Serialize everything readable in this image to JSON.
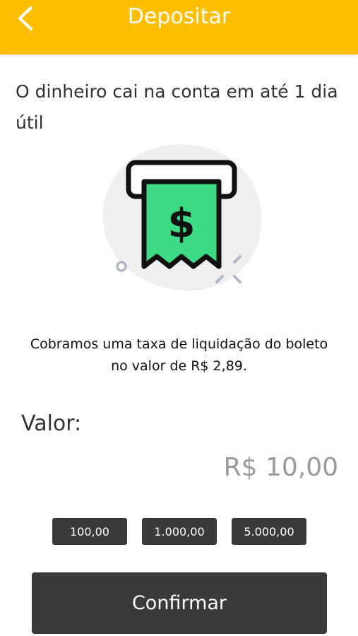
{
  "colors": {
    "header_bg": "#FFBE00",
    "button_bg": "#3a3a3c",
    "receipt_green": "#3ddc84",
    "amount_text": "#9a9a9a"
  },
  "header": {
    "title": "Depositar",
    "back_icon": "chevron-left-icon"
  },
  "main": {
    "headline": "O dinheiro cai na conta em até 1 dia útil",
    "illustration_icon": "boleto-receipt-icon",
    "fee_note": "Cobramos uma taxa de liquidação do boleto no valor de R$ 2,89.",
    "valor_label": "Valor:",
    "amount_value": "R$ 10,00",
    "quick_amounts": [
      "100,00",
      "1.000,00",
      "5.000,00"
    ],
    "confirm_label": "Confirmar"
  }
}
